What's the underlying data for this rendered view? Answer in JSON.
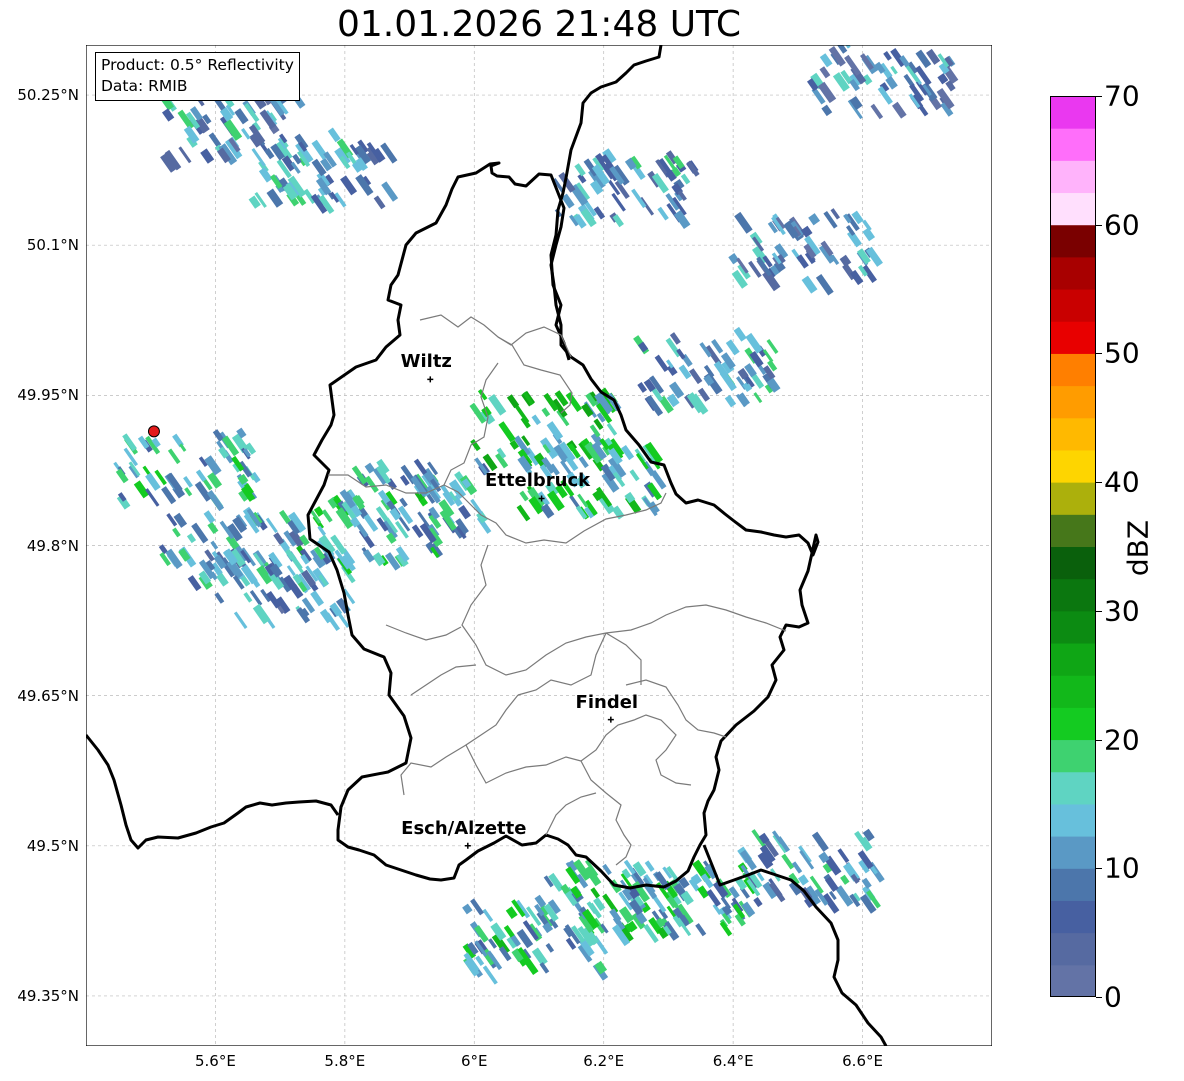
{
  "title": "01.01.2026 21:48 UTC",
  "info_box": {
    "product": "Product: 0.5° Reflectivity",
    "data": "Data: RMIB"
  },
  "map": {
    "lon_min": 5.4,
    "lon_max": 6.8,
    "lat_min": 49.3,
    "lat_max": 50.3,
    "lat_ticks": [
      {
        "value": 50.25,
        "label": "50.25°N"
      },
      {
        "value": 50.1,
        "label": "50.1°N"
      },
      {
        "value": 49.95,
        "label": "49.95°N"
      },
      {
        "value": 49.8,
        "label": "49.8°N"
      },
      {
        "value": 49.65,
        "label": "49.65°N"
      },
      {
        "value": 49.5,
        "label": "49.5°N"
      },
      {
        "value": 49.35,
        "label": "49.35°N"
      }
    ],
    "lon_ticks": [
      {
        "value": 5.6,
        "label": "5.6°E"
      },
      {
        "value": 5.8,
        "label": "5.8°E"
      },
      {
        "value": 6.0,
        "label": "6°E"
      },
      {
        "value": 6.2,
        "label": "6.2°E"
      },
      {
        "value": 6.4,
        "label": "6.4°E"
      },
      {
        "value": 6.6,
        "label": "6.6°E"
      }
    ],
    "radar_site": {
      "lon": 5.505,
      "lat": 49.914,
      "color": "#e21a1a"
    },
    "cities": [
      {
        "name": "Wiltz",
        "lon": 5.932,
        "lat": 49.966
      },
      {
        "name": "Ettelbruck",
        "lon": 6.104,
        "lat": 49.847
      },
      {
        "name": "Findel",
        "lon": 6.211,
        "lat": 49.626
      },
      {
        "name": "Esch/Alzette",
        "lon": 5.99,
        "lat": 49.5
      }
    ]
  },
  "colorbar": {
    "label": "dBZ",
    "min": 0,
    "max": 70,
    "ticks": [
      {
        "value": 0,
        "label": "0"
      },
      {
        "value": 10,
        "label": "10"
      },
      {
        "value": 20,
        "label": "20"
      },
      {
        "value": 30,
        "label": "30"
      },
      {
        "value": 40,
        "label": "40"
      },
      {
        "value": 50,
        "label": "50"
      },
      {
        "value": 60,
        "label": "60"
      },
      {
        "value": 70,
        "label": "70"
      }
    ],
    "colors": [
      "#6373a6",
      "#566aa1",
      "#4760a1",
      "#4c76ab",
      "#5a99c5",
      "#67c0dc",
      "#5fd4c2",
      "#3ed270",
      "#14cb21",
      "#12b81a",
      "#0fa615",
      "#0c8b12",
      "#0b770f",
      "#0a600c",
      "#46771a",
      "#acb00c",
      "#fed500",
      "#ffb900",
      "#ff9c00",
      "#ff7f00",
      "#e80000",
      "#c90000",
      "#a80000",
      "#7a0000",
      "#ffdffd",
      "#ffb3fb",
      "#ff6efa",
      "#ea38f0"
    ]
  },
  "chart_data": {
    "type": "radar-reflectivity-map",
    "title": "01.01.2026 21:48 UTC",
    "product": "0.5° Reflectivity",
    "source": "RMIB",
    "extent_lon": [
      5.4,
      6.8
    ],
    "extent_lat": [
      49.3,
      50.3
    ],
    "colorbar_range_dbz": [
      0,
      70
    ],
    "echo_cells": [
      {
        "lon": 5.75,
        "lat": 50.18,
        "dbz": 12
      },
      {
        "lon": 5.62,
        "lat": 50.22,
        "dbz": 10
      },
      {
        "lon": 5.55,
        "lat": 49.88,
        "dbz": 14
      },
      {
        "lon": 5.62,
        "lat": 49.8,
        "dbz": 12
      },
      {
        "lon": 5.69,
        "lat": 49.76,
        "dbz": 10
      },
      {
        "lon": 5.83,
        "lat": 49.82,
        "dbz": 15
      },
      {
        "lon": 5.9,
        "lat": 49.85,
        "dbz": 13
      },
      {
        "lon": 6.1,
        "lat": 49.92,
        "dbz": 18
      },
      {
        "lon": 6.17,
        "lat": 49.87,
        "dbz": 16
      },
      {
        "lon": 6.35,
        "lat": 49.98,
        "dbz": 12
      },
      {
        "lon": 6.22,
        "lat": 50.16,
        "dbz": 11
      },
      {
        "lon": 6.5,
        "lat": 50.1,
        "dbz": 8
      },
      {
        "lon": 6.08,
        "lat": 49.41,
        "dbz": 15
      },
      {
        "lon": 6.2,
        "lat": 49.45,
        "dbz": 16
      },
      {
        "lon": 6.33,
        "lat": 49.45,
        "dbz": 14
      },
      {
        "lon": 6.5,
        "lat": 49.48,
        "dbz": 12
      },
      {
        "lon": 6.62,
        "lat": 50.27,
        "dbz": 9
      }
    ]
  }
}
